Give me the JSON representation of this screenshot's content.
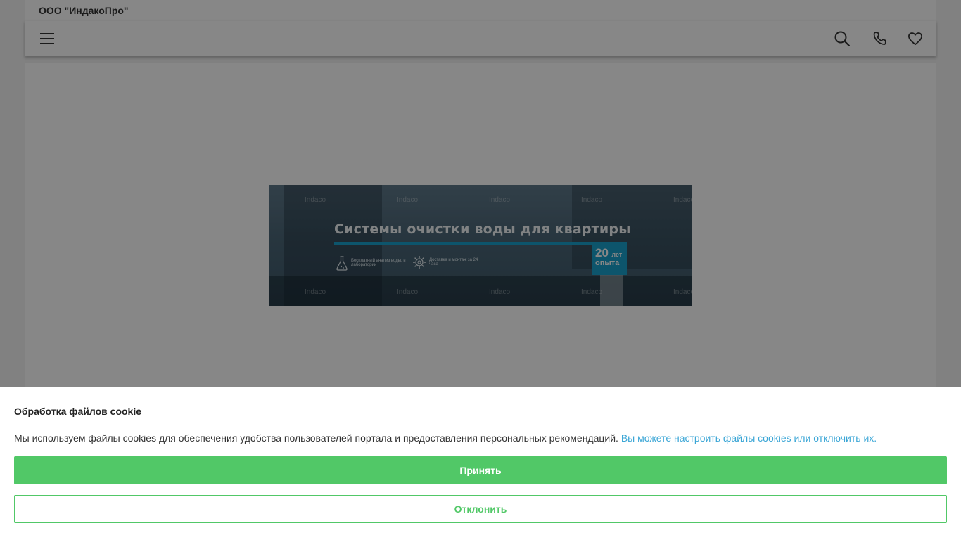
{
  "header": {
    "company_name": "ООО \"ИндакоПро\"",
    "icons": [
      "menu-icon",
      "search-icon",
      "phone-icon",
      "heart-icon"
    ]
  },
  "banner": {
    "title": "Системы очистки воды для квартиры",
    "watermark": "Indaco",
    "feature_1": "Бесплатный анализ воды, в лаборатории",
    "feature_2": "Доставка и монтаж за 24 часа",
    "years_number": "20",
    "years_unit": "лет",
    "years_text": "опыта",
    "accent_color": "#1aa1cc"
  },
  "cookie_banner": {
    "title": "Обработка файлов cookie",
    "text": "Мы используем файлы cookies для обеспечения удобства пользователей портала и предоставления персональных рекомендаций.",
    "link_text": "Вы можете настроить файлы cookies или отключить их.",
    "accept_label": "Принять",
    "decline_label": "Отклонить",
    "accent_color": "#51c867",
    "link_color": "#3ba6d6"
  }
}
